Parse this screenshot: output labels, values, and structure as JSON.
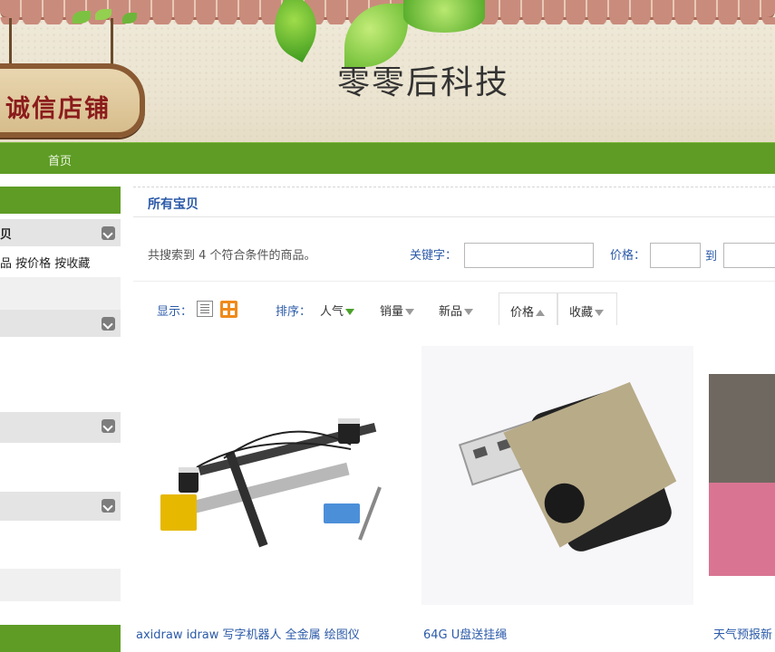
{
  "banner": {
    "shop_title": "零零后科技",
    "sign_text": "诚信店铺"
  },
  "nav": {
    "home": "首页"
  },
  "sidebar": {
    "section_header": "贝",
    "sort_links": "品 按价格 按收藏"
  },
  "main": {
    "all_title": "所有宝贝",
    "result_count": "共搜索到 4 个符合条件的商品。",
    "keyword_label": "关键字：",
    "price_label": "价格：",
    "to_label": "到",
    "display_label": "显示：",
    "sort_label": "排序：",
    "sort_options": [
      "人气",
      "销量",
      "新品",
      "价格",
      "收藏"
    ]
  },
  "products": [
    {
      "title": "axidraw idraw 写字机器人 全金属 绘图仪"
    },
    {
      "title": "64G U盘送挂绳"
    },
    {
      "title": "天气预报新"
    }
  ],
  "colors": {
    "accent_green": "#5e9c25",
    "link_blue": "#2b5aa8"
  }
}
